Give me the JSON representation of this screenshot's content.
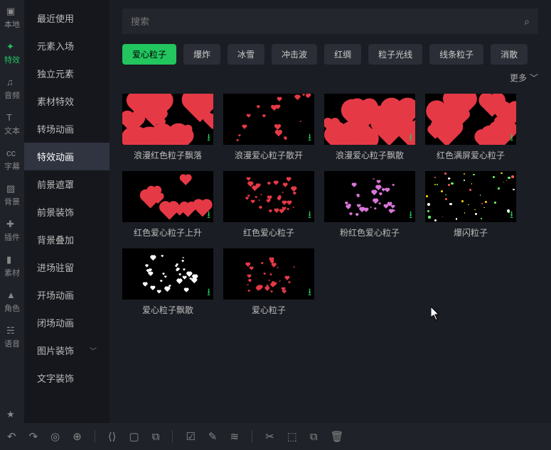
{
  "nav": [
    {
      "id": "local",
      "label": "本地"
    },
    {
      "id": "effects",
      "label": "特效",
      "active": true
    },
    {
      "id": "audio",
      "label": "音频"
    },
    {
      "id": "text",
      "label": "文本"
    },
    {
      "id": "subtitle",
      "label": "字幕"
    },
    {
      "id": "bg",
      "label": "背景"
    },
    {
      "id": "plugin",
      "label": "插件"
    },
    {
      "id": "assets",
      "label": "素材"
    },
    {
      "id": "role",
      "label": "角色"
    },
    {
      "id": "voice",
      "label": "语音"
    }
  ],
  "sub": [
    {
      "label": "最近使用"
    },
    {
      "label": "元素入场"
    },
    {
      "label": "独立元素"
    },
    {
      "label": "素材特效"
    },
    {
      "label": "转场动画"
    },
    {
      "label": "特效动画",
      "active": true
    },
    {
      "label": "前景遮罩"
    },
    {
      "label": "前景装饰"
    },
    {
      "label": "背景叠加"
    },
    {
      "label": "进场驻留"
    },
    {
      "label": "开场动画"
    },
    {
      "label": "闭场动画"
    },
    {
      "label": "图片装饰",
      "expandable": true
    },
    {
      "label": "文字装饰"
    }
  ],
  "search": {
    "placeholder": "搜索"
  },
  "filters": [
    {
      "label": "爱心粒子",
      "active": true
    },
    {
      "label": "爆炸"
    },
    {
      "label": "冰雪"
    },
    {
      "label": "冲击波"
    },
    {
      "label": "红绸"
    },
    {
      "label": "粒子光线"
    },
    {
      "label": "线条粒子"
    },
    {
      "label": "消散"
    }
  ],
  "more_label": "更多",
  "items": [
    {
      "title": "浪漫红色粒子飘落",
      "style": "big-red"
    },
    {
      "title": "浪漫爱心粒子散开",
      "style": "sparse-red"
    },
    {
      "title": "浪漫爱心粒子飘散",
      "style": "big-red"
    },
    {
      "title": "红色满屏爱心粒子",
      "style": "big-red"
    },
    {
      "title": "红色爱心粒子上升",
      "style": "mid-red"
    },
    {
      "title": "红色爱心粒子",
      "style": "tiny-red"
    },
    {
      "title": "粉红色爱心粒子",
      "style": "tiny-pink"
    },
    {
      "title": "爆闪粒子",
      "style": "dots-yellow"
    },
    {
      "title": "爱心粒子飘散",
      "style": "tiny-white"
    },
    {
      "title": "爱心粒子",
      "style": "tiny-red"
    }
  ],
  "bottombar": {
    "undo": "↶",
    "redo": "↷",
    "home": "◎",
    "target": "⊕",
    "crop1": "⟨⟩",
    "crop2": "▢",
    "dup": "⧉",
    "check": "☑",
    "edit": "✎",
    "layers": "≋",
    "cut": "✂",
    "lock": "⬚",
    "copy": "⧉",
    "trash": "🗑"
  }
}
